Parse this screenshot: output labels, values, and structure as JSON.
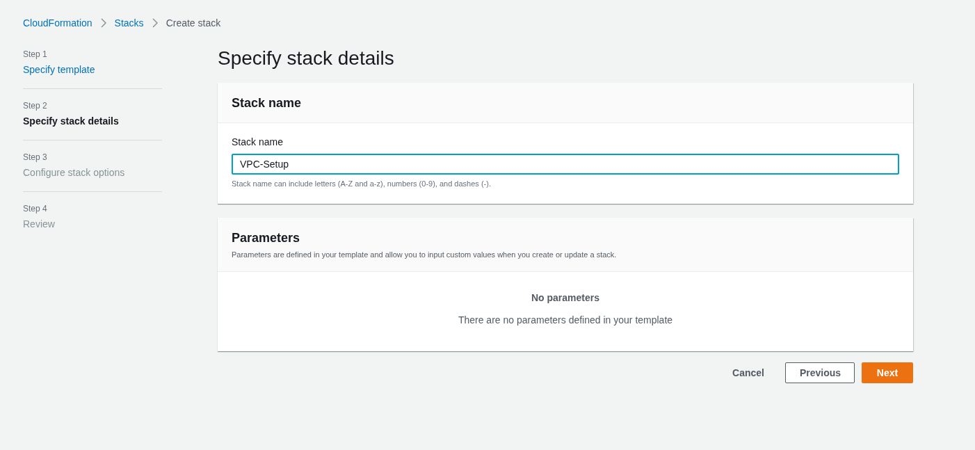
{
  "breadcrumbs": [
    {
      "label": "CloudFormation",
      "kind": "link"
    },
    {
      "label": "Stacks",
      "kind": "link"
    },
    {
      "label": "Create stack",
      "kind": "current"
    }
  ],
  "steps": [
    {
      "step": "Step 1",
      "title": "Specify template",
      "selected": false,
      "disabled": false
    },
    {
      "step": "Step 2",
      "title": "Specify stack details",
      "selected": true,
      "disabled": false
    },
    {
      "step": "Step 3",
      "title": "Configure stack options",
      "selected": false,
      "disabled": true
    },
    {
      "step": "Step 4",
      "title": "Review",
      "selected": false,
      "disabled": true
    }
  ],
  "page_title": "Specify stack details",
  "stack_name_panel": {
    "title": "Stack name",
    "field": {
      "label": "Stack name",
      "value": "VPC-Setup",
      "focused": true,
      "hint": "Stack name can include letters (A-Z and a-z), numbers (0-9), and dashes (-)."
    }
  },
  "parameters_panel": {
    "title": "Parameters",
    "description": "Parameters are defined in your template and allow you to input custom values when you create or update a stack.",
    "empty_title": "No parameters",
    "empty_text": "There are no parameters defined in your template"
  },
  "buttons": [
    {
      "label": "Cancel",
      "kind": "link"
    },
    {
      "label": "Previous",
      "kind": "normal"
    },
    {
      "label": "Next",
      "kind": "primary"
    }
  ]
}
